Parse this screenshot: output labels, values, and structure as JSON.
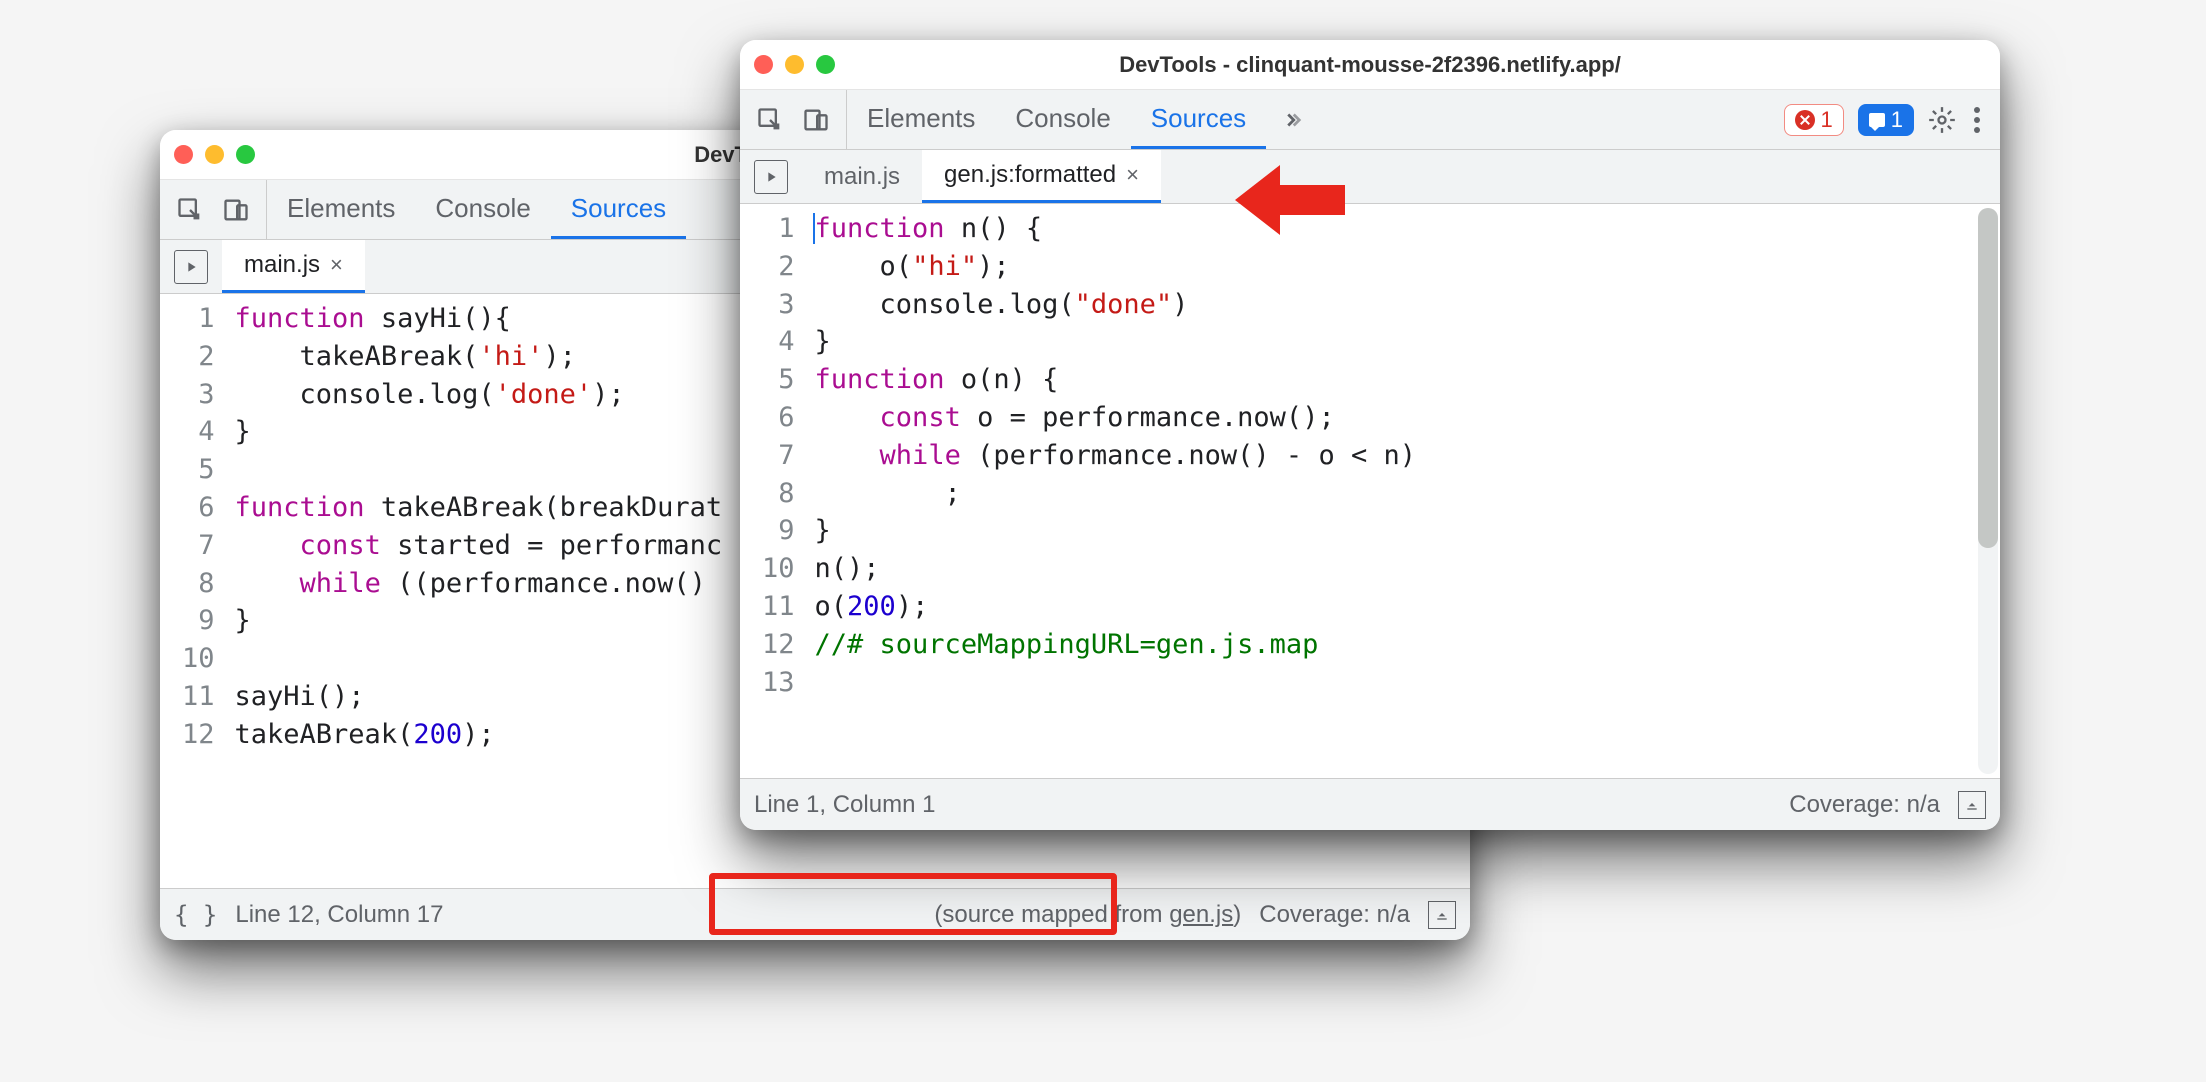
{
  "leftWindow": {
    "title": "DevTools - clinquant-m",
    "tabs": [
      "Elements",
      "Console",
      "Sources"
    ],
    "activeTab": 2,
    "fileTabs": [
      {
        "label": "main.js",
        "active": true
      }
    ],
    "gutter": " 1\n 2\n 3\n 4\n 5\n 6\n 7\n 8\n 9\n10\n11\n12",
    "status": {
      "pos": "Line 12, Column 17",
      "mappedPrefix": "(source mapped from ",
      "mappedLink": "gen.js",
      "mappedSuffix": ")",
      "coverage": "Coverage: n/a"
    },
    "code": {
      "line1_fn": "function",
      "line1_rest": " sayHi(){",
      "line2": "    takeABreak(",
      "line2_str": "'hi'",
      "line2_end": ");",
      "line3": "    console.log(",
      "line3_str": "'done'",
      "line3_end": ");",
      "line4": "}",
      "line5": "",
      "line6_fn": "function",
      "line6_rest": " takeABreak(breakDurat",
      "line7": "    ",
      "line7_const": "const",
      "line7_rest": " started = performanc",
      "line8": "    ",
      "line8_while": "while",
      "line8_rest": " ((performance.now() ",
      "line9": "}",
      "line10": "",
      "line11": "sayHi();",
      "line12": "takeABreak(",
      "line12_num": "200",
      "line12_end": ");"
    }
  },
  "rightWindow": {
    "title": "DevTools - clinquant-mousse-2f2396.netlify.app/",
    "tabs": [
      "Elements",
      "Console",
      "Sources"
    ],
    "activeTab": 2,
    "errorCount": "1",
    "infoCount": "1",
    "fileTabs": [
      {
        "label": "main.js",
        "active": false
      },
      {
        "label": "gen.js:formatted",
        "active": true
      }
    ],
    "gutter": " 1\n 2\n 3\n 4\n 5\n 6\n 7\n 8\n 9\n10\n11\n12\n13",
    "status": {
      "pos": "Line 1, Column 1",
      "coverage": "Coverage: n/a"
    },
    "code": {
      "l1a": "function",
      "l1b": " n() {",
      "l2a": "    o(",
      "l2str": "\"hi\"",
      "l2b": ");",
      "l3a": "    console.log(",
      "l3str": "\"done\"",
      "l3b": ")",
      "l4": "}",
      "l5a": "function",
      "l5b": " o(n) {",
      "l6a": "    ",
      "l6const": "const",
      "l6b": " o = performance.now();",
      "l7a": "    ",
      "l7while": "while",
      "l7b": " (performance.now() - o < n)",
      "l8": "        ;",
      "l9": "}",
      "l10": "n();",
      "l11a": "o(",
      "l11num": "200",
      "l11b": ");",
      "l12": "//# sourceMappingURL=gen.js.map",
      "l13": ""
    }
  }
}
